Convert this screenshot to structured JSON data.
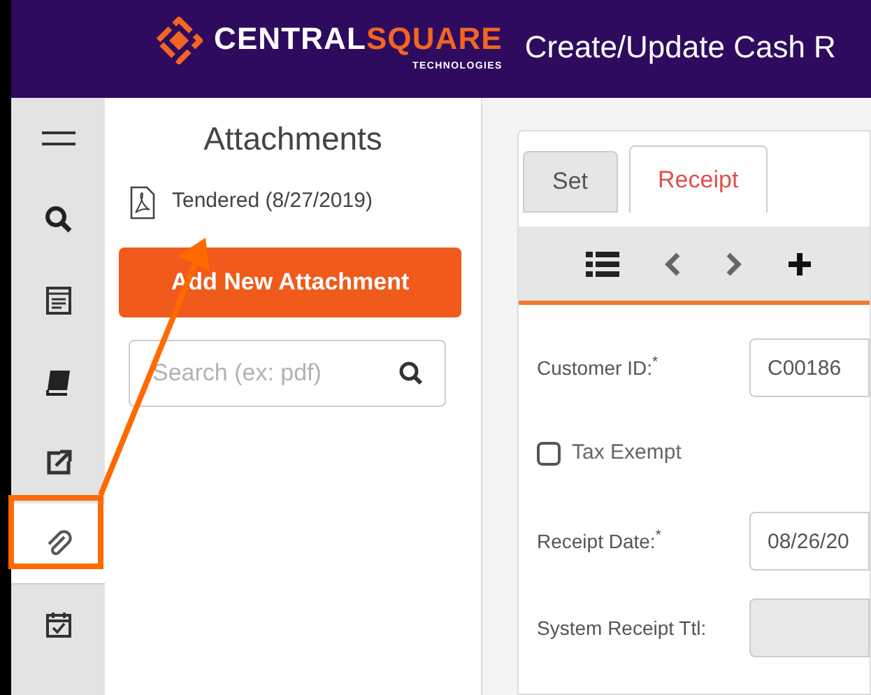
{
  "header": {
    "logo_parts": [
      "CENTRAL",
      "SQUARE"
    ],
    "logo_subtitle": "TECHNOLOGIES",
    "title": "Create/Update Cash R"
  },
  "sidebar": {
    "items": [
      {
        "kind": "menu",
        "selected": false
      },
      {
        "kind": "search",
        "selected": false
      },
      {
        "kind": "list",
        "selected": false
      },
      {
        "kind": "book",
        "selected": false
      },
      {
        "kind": "external",
        "selected": false
      },
      {
        "kind": "attach",
        "selected": true
      },
      {
        "kind": "calendar",
        "selected": false
      }
    ]
  },
  "attachments": {
    "title": "Attachments",
    "files": [
      {
        "name": "Tendered (8/27/2019)"
      }
    ],
    "add_button": "Add New Attachment",
    "search": {
      "placeholder": "Search (ex: pdf)"
    }
  },
  "form": {
    "tabs": [
      {
        "label": "Set",
        "selected": false
      },
      {
        "label": "Receipt",
        "selected": true
      }
    ],
    "fields": [
      {
        "kind": "text",
        "label": "Customer ID:$^{*}$",
        "value": "C00186"
      },
      {
        "kind": "checkbox",
        "label": "Tax Exempt",
        "checked": false
      },
      {
        "kind": "text",
        "label": "Receipt Date:$^{*}$",
        "value": "08/26/20"
      },
      {
        "kind": "text",
        "label": "System Receipt Ttl:",
        "disabled": true
      }
    ]
  }
}
